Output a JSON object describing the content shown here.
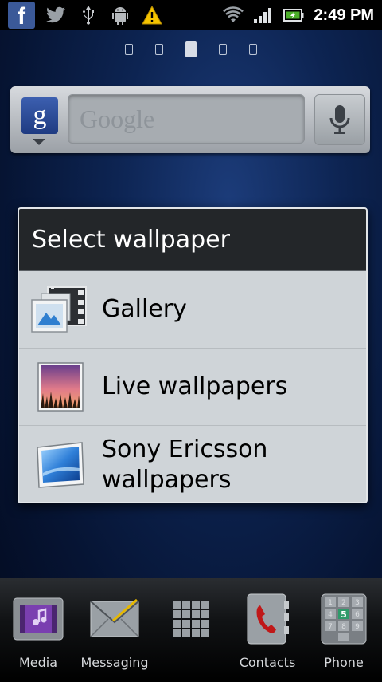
{
  "status_bar": {
    "time": "2:49 PM",
    "icons": [
      "facebook-icon",
      "twitter-icon",
      "usb-icon",
      "android-icon",
      "warning-icon",
      "wifi-icon",
      "signal-icon",
      "battery-icon"
    ],
    "fb_glyph": "f"
  },
  "home": {
    "page_count": 5,
    "active_page": 2
  },
  "search_widget": {
    "placeholder": "Google",
    "g_glyph": "g"
  },
  "dialog": {
    "title": "Select wallpaper",
    "items": [
      {
        "label": "Gallery",
        "icon": "gallery-icon"
      },
      {
        "label": "Live wallpapers",
        "icon": "live-wallpapers-icon"
      },
      {
        "label": "Sony Ericsson wallpapers",
        "icon": "sony-ericsson-wallpapers-icon"
      }
    ]
  },
  "dock": {
    "items": [
      {
        "label": "Media",
        "icon": "media-icon"
      },
      {
        "label": "Messaging",
        "icon": "messaging-icon"
      },
      {
        "label": "",
        "icon": "app-drawer-icon"
      },
      {
        "label": "Contacts",
        "icon": "contacts-icon"
      },
      {
        "label": "Phone",
        "icon": "phone-icon"
      }
    ]
  },
  "colors": {
    "accent_blue": "#3b5998",
    "warning": "#f5c400",
    "battery_green": "#4caf2a"
  }
}
